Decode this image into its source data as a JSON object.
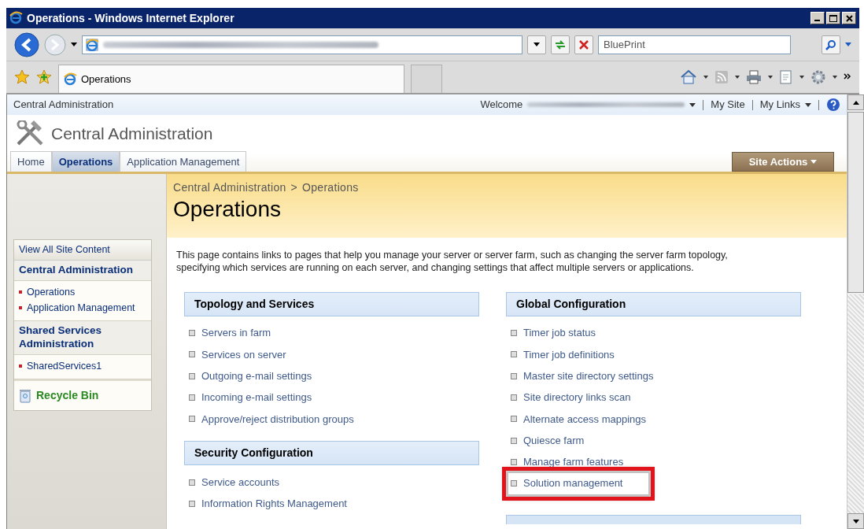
{
  "window": {
    "title": "Operations - Windows Internet Explorer"
  },
  "browser": {
    "search": {
      "value": "BluePrint"
    },
    "tab": {
      "label": "Operations"
    }
  },
  "site": {
    "top_title": "Central Administration",
    "welcome": "Welcome",
    "user_links": [
      "My Site",
      "My Links"
    ],
    "title": "Central Administration",
    "tabs": [
      {
        "label": "Home",
        "selected": false
      },
      {
        "label": "Operations",
        "selected": true
      },
      {
        "label": "Application Management",
        "selected": false
      }
    ],
    "site_actions": "Site Actions"
  },
  "left_nav": {
    "view_all": "View All Site Content",
    "sections": [
      {
        "heading": "Central Administration",
        "items": [
          "Operations",
          "Application Management"
        ]
      },
      {
        "heading": "Shared Services Administration",
        "items": [
          "SharedServices1"
        ]
      }
    ],
    "recycle_bin": "Recycle Bin"
  },
  "main": {
    "breadcrumb": [
      "Central Administration",
      ">",
      "Operations"
    ],
    "title": "Operations",
    "description": "This page contains links to pages that help you manage your server or server farm, such as changing the server farm topology, specifying which services are running on each server, and changing settings that affect multiple servers or applications.",
    "columns": [
      [
        {
          "heading": "Topology and Services",
          "links": [
            {
              "label": "Servers in farm",
              "highlighted": false
            },
            {
              "label": "Services on server",
              "highlighted": false
            },
            {
              "label": "Outgoing e-mail settings",
              "highlighted": false
            },
            {
              "label": "Incoming e-mail settings",
              "highlighted": false
            },
            {
              "label": "Approve/reject distribution groups",
              "highlighted": false
            }
          ]
        },
        {
          "heading": "Security Configuration",
          "links": [
            {
              "label": "Service accounts",
              "highlighted": false
            },
            {
              "label": "Information Rights Management",
              "highlighted": false
            }
          ]
        }
      ],
      [
        {
          "heading": "Global Configuration",
          "links": [
            {
              "label": "Timer job status",
              "highlighted": false
            },
            {
              "label": "Timer job definitions",
              "highlighted": false
            },
            {
              "label": "Master site directory settings",
              "highlighted": false
            },
            {
              "label": "Site directory links scan",
              "highlighted": false
            },
            {
              "label": "Alternate access mappings",
              "highlighted": false
            },
            {
              "label": "Quiesce farm",
              "highlighted": false
            },
            {
              "label": "Manage farm features",
              "highlighted": false
            },
            {
              "label": "Solution management",
              "highlighted": true
            }
          ]
        }
      ]
    ]
  }
}
